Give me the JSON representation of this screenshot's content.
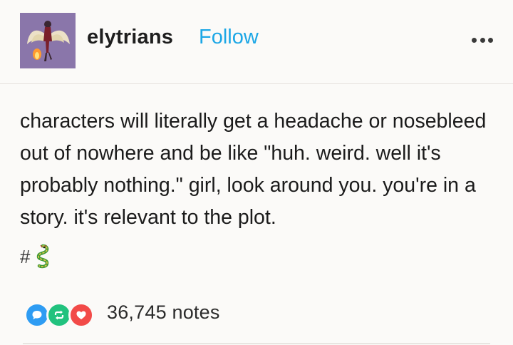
{
  "header": {
    "blog_name": "elytrians",
    "follow_label": "Follow",
    "avatar_icon": "winged-character-avatar",
    "more_icon": "more-dots-icon"
  },
  "post": {
    "text": "characters will literally get a headache or nosebleed out of nowhere and be like \"huh. weird. well it's probably nothing.\" girl, look around you. you're in a story. it's relevant to the plot.",
    "tag": {
      "hash": "#",
      "emoji_icon": "dragon-emoji"
    }
  },
  "footer": {
    "notes_count": "36,745 notes",
    "note_icons": [
      "reply-icon",
      "reblog-icon",
      "like-icon"
    ]
  },
  "colors": {
    "follow": "#1ca7e6",
    "reply": "#2e9cf3",
    "reblog": "#21c27e",
    "like": "#f24a48",
    "avatar_bg": "#8a76aa"
  }
}
